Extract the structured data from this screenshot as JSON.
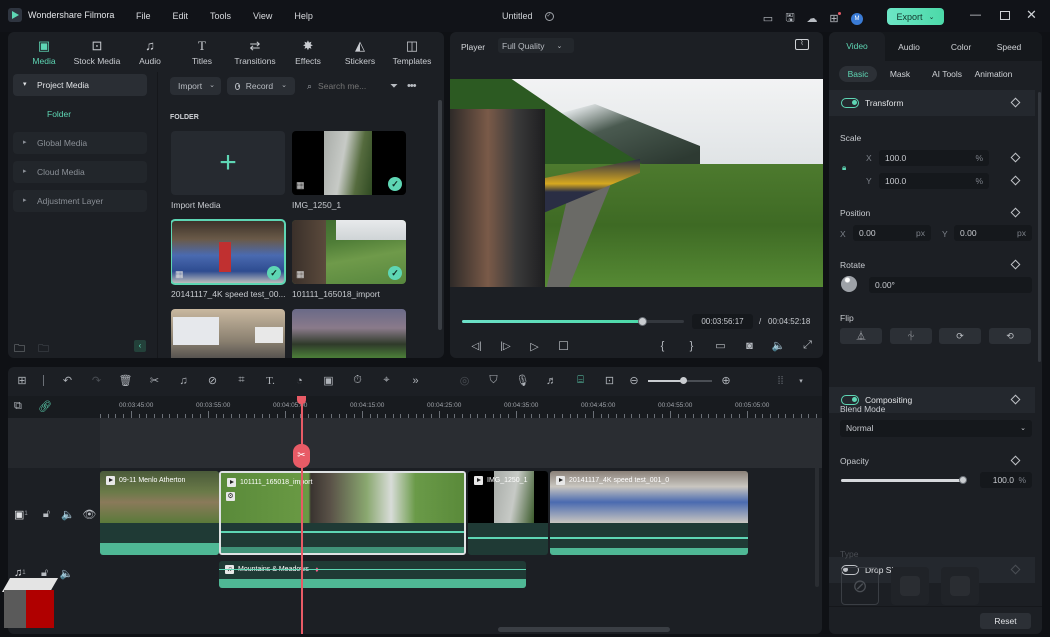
{
  "app": {
    "name": "Wondershare Filmora",
    "menu": [
      "File",
      "Edit",
      "Tools",
      "View",
      "Help"
    ],
    "project_title": "Untitled",
    "avatar_initial": "M",
    "export_label": "Export"
  },
  "nav_tabs": [
    {
      "label": "Media",
      "icon": "media-icon",
      "glyph": "▣",
      "active": true
    },
    {
      "label": "Stock Media",
      "icon": "stock-media-icon",
      "glyph": "⊡"
    },
    {
      "label": "Audio",
      "icon": "music-note-icon",
      "glyph": "♫"
    },
    {
      "label": "Titles",
      "icon": "titles-icon",
      "glyph": "T"
    },
    {
      "label": "Transitions",
      "icon": "transitions-icon",
      "glyph": "⇄"
    },
    {
      "label": "Effects",
      "icon": "effects-icon",
      "glyph": "✸"
    },
    {
      "label": "Stickers",
      "icon": "stickers-icon",
      "glyph": "◭"
    },
    {
      "label": "Templates",
      "icon": "templates-icon",
      "glyph": "◫"
    }
  ],
  "sidebar": {
    "items": [
      {
        "label": "Project Media",
        "open": true
      },
      {
        "label": "Folder",
        "sub": true
      },
      {
        "label": "Global Media"
      },
      {
        "label": "Cloud Media"
      },
      {
        "label": "Adjustment Layer"
      }
    ]
  },
  "media_toolbar": {
    "import_label": "Import",
    "record_label": "Record",
    "search_placeholder": "Search me..."
  },
  "media": {
    "section_label": "FOLDER",
    "items": [
      {
        "label": "Import Media"
      },
      {
        "label": "IMG_1250_1",
        "checked": true
      },
      {
        "label": "20141117_4K speed test_00...",
        "checked": true,
        "selected": true
      },
      {
        "label": "101111_165018_import",
        "checked": true
      },
      {
        "label": ""
      },
      {
        "label": ""
      }
    ]
  },
  "player": {
    "label": "Player",
    "quality": "Full Quality",
    "current_time": "00:03:56:17",
    "separator": "/",
    "total_time": "00:04:52:18",
    "progress": 0.81
  },
  "inspector": {
    "tabs": [
      "Video",
      "Audio",
      "Color",
      "Speed"
    ],
    "subtabs": [
      "Basic",
      "Mask",
      "AI Tools",
      "Animation"
    ],
    "transform": {
      "label": "Transform",
      "enabled": true,
      "scale_label": "Scale",
      "scale_x": "100.0",
      "scale_y": "100.0",
      "scale_unit": "%",
      "position_label": "Position",
      "pos_x": "0.00",
      "pos_y": "0.00",
      "pos_unit": "px",
      "rotate_label": "Rotate",
      "rotate_value": "0.00°",
      "flip_label": "Flip"
    },
    "compositing": {
      "label": "Compositing",
      "enabled": true,
      "blend_label": "Blend Mode",
      "blend_value": "Normal",
      "opacity_label": "Opacity",
      "opacity_value": "100.0",
      "opacity_unit": "%",
      "opacity_fraction": 1.0
    },
    "drop_shadow": {
      "label": "Drop Shadow",
      "enabled": false,
      "type_label": "Type"
    },
    "reset_label": "Reset"
  },
  "timeline": {
    "ruler": [
      "00:03:45:00",
      "00:03:55:00",
      "00:04:05:00",
      "00:04:15:00",
      "00:04:25:00",
      "00:04:35:00",
      "00:04:45:00",
      "00:04:55:00",
      "00:05:05:00"
    ],
    "zoom_fraction": 0.55,
    "video_track_number": "1",
    "audio_track_number": "1",
    "video_clips": [
      {
        "label": "09-11 Menlo Atherton"
      },
      {
        "label": "101111_165018_import"
      },
      {
        "label": "IMG_1250_1"
      },
      {
        "label": "20141117_4K speed test_001_0"
      }
    ],
    "audio_clips": [
      {
        "label": "Mountains & Meadows"
      }
    ]
  },
  "colors": {
    "accent": "#5ed6b4",
    "playhead": "#e85b66",
    "panel": "#1c1f24",
    "background": "#0f1115"
  }
}
